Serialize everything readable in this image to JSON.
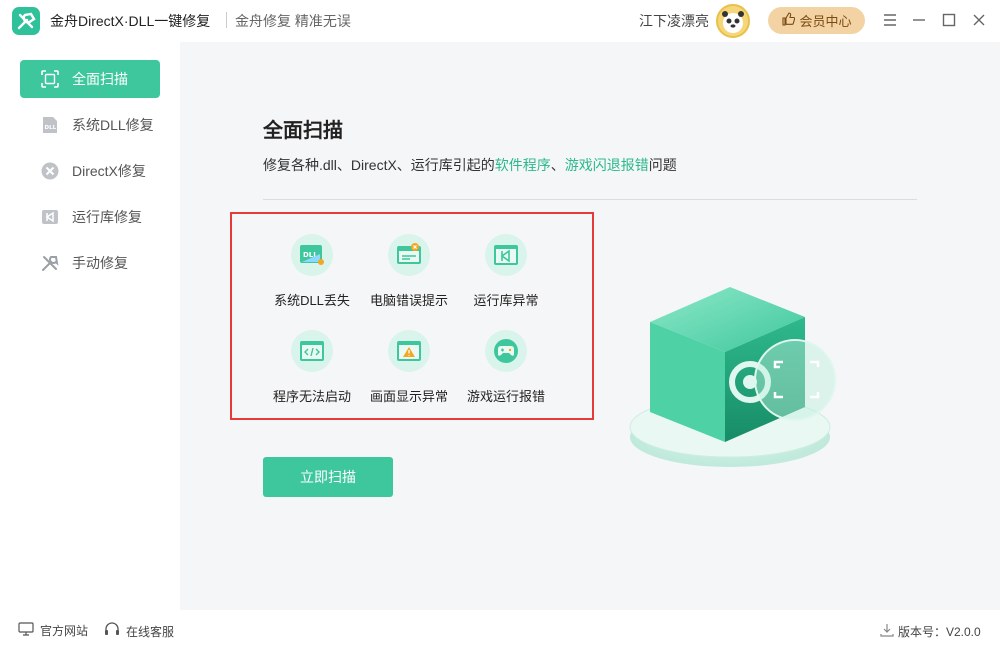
{
  "header": {
    "app_title": "金舟DirectX·DLL一键修复",
    "slogan": "金舟修复 精准无误",
    "username": "江下凌漂亮",
    "vip_label": "会员中心"
  },
  "sidebar": {
    "items": [
      {
        "label": "全面扫描",
        "icon": "scan-icon",
        "active": true
      },
      {
        "label": "系统DLL修复",
        "icon": "dll-icon"
      },
      {
        "label": "DirectX修复",
        "icon": "directx-icon"
      },
      {
        "label": "运行库修复",
        "icon": "runtime-icon"
      },
      {
        "label": "手动修复",
        "icon": "wrench-icon"
      }
    ]
  },
  "main": {
    "title": "全面扫描",
    "desc_prefix": "修复各种.dll、DirectX、运行库引起的",
    "desc_hl1": "软件程序",
    "desc_mid": "、",
    "desc_hl2": "游戏闪退报错",
    "desc_suffix": "问题",
    "features": [
      {
        "label": "系统DLL丢失",
        "icon": "dll-file-icon"
      },
      {
        "label": "电脑错误提示",
        "icon": "error-window-icon"
      },
      {
        "label": "运行库异常",
        "icon": "runtime-window-icon"
      },
      {
        "label": "程序无法启动",
        "icon": "code-window-icon"
      },
      {
        "label": "画面显示异常",
        "icon": "warning-window-icon"
      },
      {
        "label": "游戏运行报错",
        "icon": "gamepad-icon"
      }
    ],
    "scan_button": "立即扫描"
  },
  "footer": {
    "website": "官方网站",
    "support": "在线客服",
    "version_label": "版本号：V2.0.0"
  },
  "colors": {
    "accent": "#3ec79d",
    "highlight_text": "#2bb98c",
    "annotation_border": "#e53a3a",
    "vip_bg": "#f3d3a4"
  }
}
